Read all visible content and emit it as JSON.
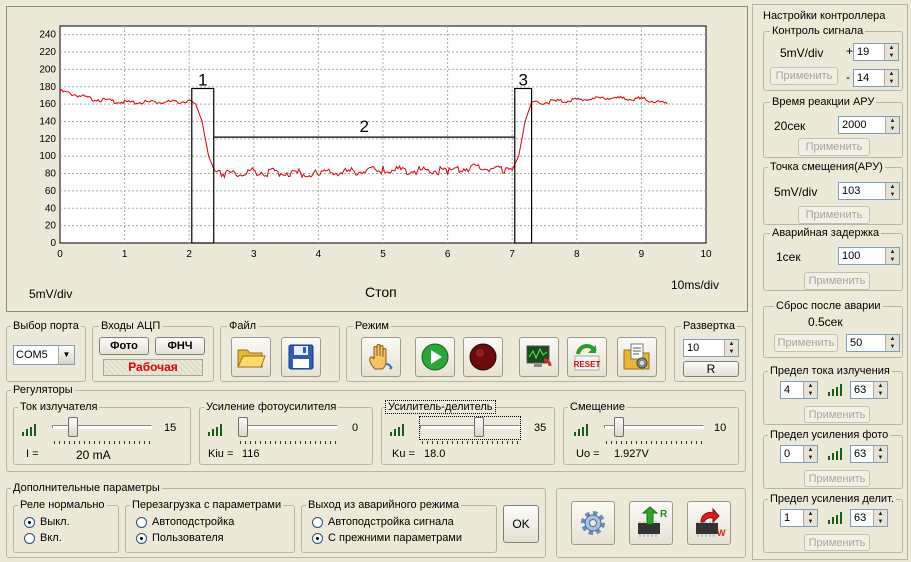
{
  "chart_data": {
    "type": "line",
    "x_ticks": [
      "0",
      "1",
      "2",
      "3",
      "4",
      "5",
      "6",
      "7",
      "8",
      "9",
      "10"
    ],
    "y_ticks": [
      "0",
      "20",
      "40",
      "60",
      "80",
      "100",
      "120",
      "140",
      "160",
      "180",
      "200",
      "220",
      "240"
    ],
    "xlim": [
      0,
      10
    ],
    "ylim": [
      0,
      250
    ],
    "grid": true,
    "series": [
      {
        "color": "#e00000",
        "x": [
          0,
          0.5,
          1.0,
          1.5,
          2.0,
          2.1,
          2.2,
          2.3,
          2.4,
          2.5,
          3,
          4,
          5,
          6,
          6.5,
          6.9,
          7.0,
          7.1,
          7.2,
          7.3,
          7.5,
          8,
          8.5,
          9,
          9.4
        ],
        "y": [
          175,
          166,
          162,
          162,
          163,
          160,
          140,
          100,
          82,
          80,
          82,
          80,
          84,
          83,
          88,
          83,
          84,
          100,
          140,
          162,
          162,
          165,
          167,
          166,
          160
        ]
      }
    ],
    "boxes": [
      {
        "label": "1",
        "x": [
          2.04,
          2.38
        ],
        "y": [
          0,
          178
        ]
      },
      {
        "label": "3",
        "x": [
          7.04,
          7.3
        ],
        "y": [
          0,
          178
        ]
      }
    ],
    "bracket": {
      "label": "2",
      "x": [
        2.38,
        7.04
      ],
      "y": 122
    },
    "scale_left": "5mV/div",
    "scale_right": "10ms/div",
    "center_label": "Стоп"
  },
  "ports": {
    "title": "Выбор порта",
    "value": "COM5"
  },
  "adc": {
    "title": "Входы АЦП",
    "photo": "Фото",
    "lpf": "ФНЧ",
    "status": "Рабочая"
  },
  "file": {
    "title": "Файл"
  },
  "mode": {
    "title": "Режим",
    "reset": "RESET"
  },
  "sweep": {
    "title": "Развертка",
    "value": "10",
    "r_label": "R"
  },
  "regulators": {
    "title": "Регуляторы",
    "emitter": {
      "title": "Ток излучателя",
      "value": "15",
      "readout_label": "I =",
      "readout": "20 mA"
    },
    "photo_amp": {
      "title": "Усиление фотоусилителя",
      "value": "0",
      "readout_label": "Kiu =",
      "readout": "116"
    },
    "divider": {
      "title": "Усилитель-делитель",
      "value": "35",
      "readout_label": "Ku =",
      "readout": "18.0"
    },
    "offset": {
      "title": "Смещение",
      "value": "10",
      "readout_label": "Uo =",
      "readout": "1.927V"
    }
  },
  "extra": {
    "title": "Дополнительные параметры",
    "relay": {
      "title": "Реле нормально",
      "off": "Выкл.",
      "on": "Вкл."
    },
    "reload": {
      "title": "Перезагрузка с параметрами",
      "auto": "Автоподстройка",
      "user": "Пользователя"
    },
    "exit": {
      "title": "Выход из аварийного режима",
      "auto": "Автоподстройка  сигнала",
      "prev": "С прежними параметрами"
    },
    "ok": "OK"
  },
  "controller": {
    "title": "Настройки контроллера",
    "signal": {
      "title": "Контроль сигнала",
      "unit": "5mV/div",
      "plus": "+",
      "minus": "-",
      "high": "19",
      "low": "14",
      "apply": "Применить"
    },
    "agc_time": {
      "title": "Время реакции АРУ",
      "label": "20сек",
      "value": "2000",
      "apply": "Применить"
    },
    "agc_offset": {
      "title": "Точка смещения(АРУ)",
      "label": "5mV/div",
      "value": "103",
      "apply": "Применить"
    },
    "alarm_delay": {
      "title": "Аварийная задержка",
      "label": "1сек",
      "value": "100",
      "apply": "Применить"
    },
    "alarm_reset": {
      "title": "Сброс после аварии",
      "label": "0.5сек",
      "value": "50",
      "apply": "Применить"
    },
    "emit_limit": {
      "title": "Предел тока излучения",
      "low": "4",
      "high": "63",
      "apply": "Применить"
    },
    "photo_limit": {
      "title": "Предел усиления фото",
      "low": "0",
      "high": "63",
      "apply": "Применить"
    },
    "div_limit": {
      "title": "Предел усиления делит.",
      "low": "1",
      "high": "63",
      "apply": "Применить"
    }
  }
}
